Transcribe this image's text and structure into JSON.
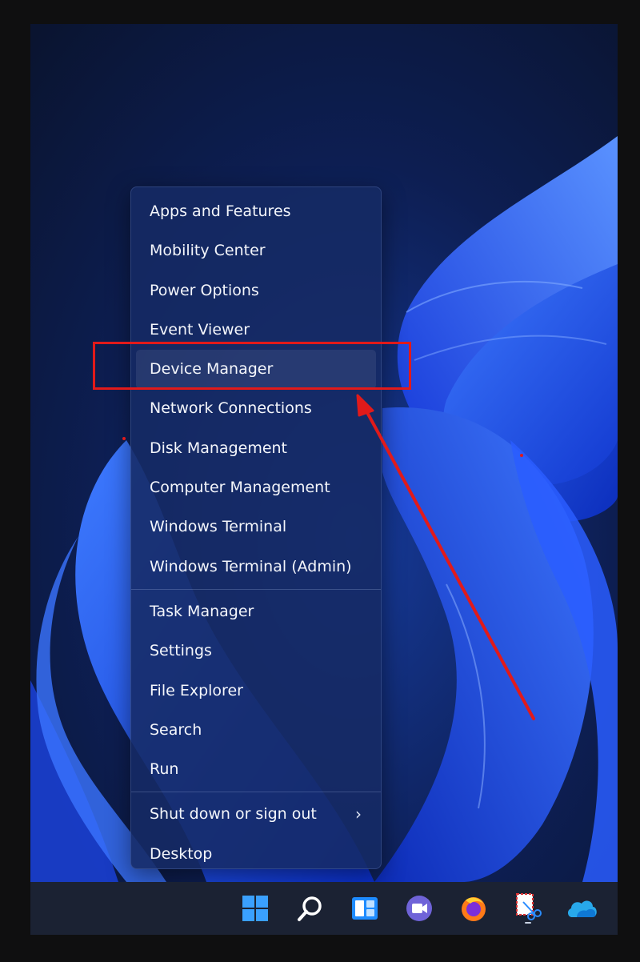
{
  "context_menu": {
    "items_group1": [
      {
        "label": "Apps and Features"
      },
      {
        "label": "Mobility Center"
      },
      {
        "label": "Power Options"
      },
      {
        "label": "Event Viewer"
      },
      {
        "label": "Device Manager"
      },
      {
        "label": "Network Connections"
      },
      {
        "label": "Disk Management"
      },
      {
        "label": "Computer Management"
      },
      {
        "label": "Windows Terminal"
      },
      {
        "label": "Windows Terminal (Admin)"
      }
    ],
    "items_group2": [
      {
        "label": "Task Manager"
      },
      {
        "label": "Settings"
      },
      {
        "label": "File Explorer"
      },
      {
        "label": "Search"
      },
      {
        "label": "Run"
      }
    ],
    "items_group3": [
      {
        "label": "Shut down or sign out",
        "chevron": "›"
      },
      {
        "label": "Desktop"
      }
    ],
    "highlighted_item": "Device Manager"
  },
  "taskbar": {
    "icons": [
      "windows-start-icon",
      "search-icon",
      "widgets-icon",
      "teams-chat-icon",
      "firefox-icon",
      "snipping-tool-icon",
      "onedrive-icon"
    ]
  },
  "annotation": {
    "color": "#e11a1a",
    "target": "Device Manager"
  },
  "colors": {
    "accent": "#2d6cf5",
    "menu_background": "#162a64"
  }
}
